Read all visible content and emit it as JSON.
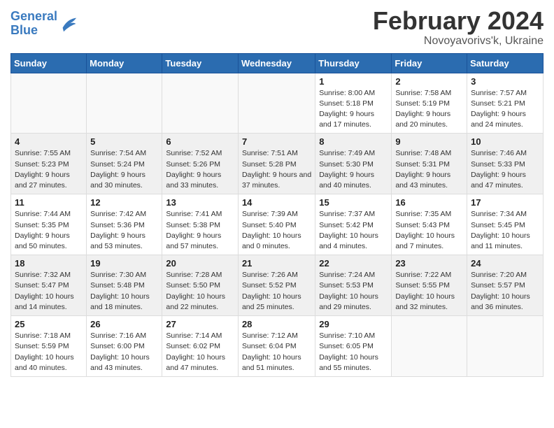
{
  "header": {
    "logo_line1": "General",
    "logo_line2": "Blue",
    "month_year": "February 2024",
    "location": "Novoyavorivs'k, Ukraine"
  },
  "weekdays": [
    "Sunday",
    "Monday",
    "Tuesday",
    "Wednesday",
    "Thursday",
    "Friday",
    "Saturday"
  ],
  "weeks": [
    [
      {
        "day": "",
        "info": ""
      },
      {
        "day": "",
        "info": ""
      },
      {
        "day": "",
        "info": ""
      },
      {
        "day": "",
        "info": ""
      },
      {
        "day": "1",
        "info": "Sunrise: 8:00 AM\nSunset: 5:18 PM\nDaylight: 9 hours\nand 17 minutes."
      },
      {
        "day": "2",
        "info": "Sunrise: 7:58 AM\nSunset: 5:19 PM\nDaylight: 9 hours\nand 20 minutes."
      },
      {
        "day": "3",
        "info": "Sunrise: 7:57 AM\nSunset: 5:21 PM\nDaylight: 9 hours\nand 24 minutes."
      }
    ],
    [
      {
        "day": "4",
        "info": "Sunrise: 7:55 AM\nSunset: 5:23 PM\nDaylight: 9 hours\nand 27 minutes."
      },
      {
        "day": "5",
        "info": "Sunrise: 7:54 AM\nSunset: 5:24 PM\nDaylight: 9 hours\nand 30 minutes."
      },
      {
        "day": "6",
        "info": "Sunrise: 7:52 AM\nSunset: 5:26 PM\nDaylight: 9 hours\nand 33 minutes."
      },
      {
        "day": "7",
        "info": "Sunrise: 7:51 AM\nSunset: 5:28 PM\nDaylight: 9 hours\nand 37 minutes."
      },
      {
        "day": "8",
        "info": "Sunrise: 7:49 AM\nSunset: 5:30 PM\nDaylight: 9 hours\nand 40 minutes."
      },
      {
        "day": "9",
        "info": "Sunrise: 7:48 AM\nSunset: 5:31 PM\nDaylight: 9 hours\nand 43 minutes."
      },
      {
        "day": "10",
        "info": "Sunrise: 7:46 AM\nSunset: 5:33 PM\nDaylight: 9 hours\nand 47 minutes."
      }
    ],
    [
      {
        "day": "11",
        "info": "Sunrise: 7:44 AM\nSunset: 5:35 PM\nDaylight: 9 hours\nand 50 minutes."
      },
      {
        "day": "12",
        "info": "Sunrise: 7:42 AM\nSunset: 5:36 PM\nDaylight: 9 hours\nand 53 minutes."
      },
      {
        "day": "13",
        "info": "Sunrise: 7:41 AM\nSunset: 5:38 PM\nDaylight: 9 hours\nand 57 minutes."
      },
      {
        "day": "14",
        "info": "Sunrise: 7:39 AM\nSunset: 5:40 PM\nDaylight: 10 hours\nand 0 minutes."
      },
      {
        "day": "15",
        "info": "Sunrise: 7:37 AM\nSunset: 5:42 PM\nDaylight: 10 hours\nand 4 minutes."
      },
      {
        "day": "16",
        "info": "Sunrise: 7:35 AM\nSunset: 5:43 PM\nDaylight: 10 hours\nand 7 minutes."
      },
      {
        "day": "17",
        "info": "Sunrise: 7:34 AM\nSunset: 5:45 PM\nDaylight: 10 hours\nand 11 minutes."
      }
    ],
    [
      {
        "day": "18",
        "info": "Sunrise: 7:32 AM\nSunset: 5:47 PM\nDaylight: 10 hours\nand 14 minutes."
      },
      {
        "day": "19",
        "info": "Sunrise: 7:30 AM\nSunset: 5:48 PM\nDaylight: 10 hours\nand 18 minutes."
      },
      {
        "day": "20",
        "info": "Sunrise: 7:28 AM\nSunset: 5:50 PM\nDaylight: 10 hours\nand 22 minutes."
      },
      {
        "day": "21",
        "info": "Sunrise: 7:26 AM\nSunset: 5:52 PM\nDaylight: 10 hours\nand 25 minutes."
      },
      {
        "day": "22",
        "info": "Sunrise: 7:24 AM\nSunset: 5:53 PM\nDaylight: 10 hours\nand 29 minutes."
      },
      {
        "day": "23",
        "info": "Sunrise: 7:22 AM\nSunset: 5:55 PM\nDaylight: 10 hours\nand 32 minutes."
      },
      {
        "day": "24",
        "info": "Sunrise: 7:20 AM\nSunset: 5:57 PM\nDaylight: 10 hours\nand 36 minutes."
      }
    ],
    [
      {
        "day": "25",
        "info": "Sunrise: 7:18 AM\nSunset: 5:59 PM\nDaylight: 10 hours\nand 40 minutes."
      },
      {
        "day": "26",
        "info": "Sunrise: 7:16 AM\nSunset: 6:00 PM\nDaylight: 10 hours\nand 43 minutes."
      },
      {
        "day": "27",
        "info": "Sunrise: 7:14 AM\nSunset: 6:02 PM\nDaylight: 10 hours\nand 47 minutes."
      },
      {
        "day": "28",
        "info": "Sunrise: 7:12 AM\nSunset: 6:04 PM\nDaylight: 10 hours\nand 51 minutes."
      },
      {
        "day": "29",
        "info": "Sunrise: 7:10 AM\nSunset: 6:05 PM\nDaylight: 10 hours\nand 55 minutes."
      },
      {
        "day": "",
        "info": ""
      },
      {
        "day": "",
        "info": ""
      }
    ]
  ]
}
